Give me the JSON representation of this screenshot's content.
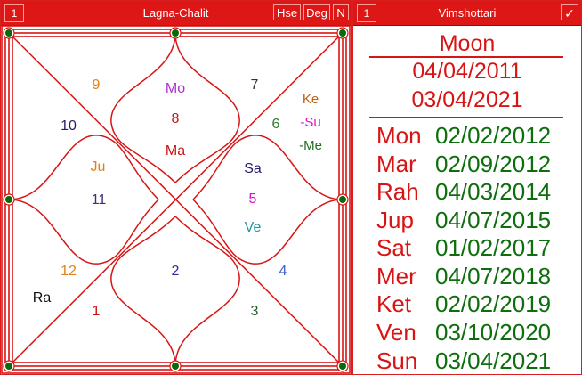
{
  "left_panel": {
    "number": "1",
    "title": "Lagna-Chalit",
    "buttons": {
      "hse": "Hse",
      "deg": "Deg",
      "n": "N"
    },
    "houses": [
      {
        "num": "1",
        "color": "#cc1111"
      },
      {
        "num": "2",
        "color": "#2c2c9a"
      },
      {
        "num": "3",
        "color": "#1e5c1e"
      },
      {
        "num": "4",
        "color": "#3c5ec8"
      },
      {
        "num": "5",
        "color": "#e010c8"
      },
      {
        "num": "6",
        "color": "#2e7d2e"
      },
      {
        "num": "7",
        "color": "#333333"
      },
      {
        "num": "8",
        "color": "#cc1111"
      },
      {
        "num": "9",
        "color": "#e08214"
      },
      {
        "num": "10",
        "color": "#2a1a6a"
      },
      {
        "num": "11",
        "color": "#4a2a7a"
      },
      {
        "num": "12",
        "color": "#e08214"
      }
    ],
    "planets": [
      {
        "label": "Mo",
        "color": "#b030d0"
      },
      {
        "label": "Ma",
        "color": "#cc1111"
      },
      {
        "label": "Ke",
        "color": "#c06010"
      },
      {
        "label": "-Su",
        "color": "#e010c8"
      },
      {
        "label": "-Me",
        "color": "#1e6e1e"
      },
      {
        "label": "Ju",
        "color": "#e08214"
      },
      {
        "label": "Sa",
        "color": "#2a1a6a"
      },
      {
        "label": "Ve",
        "color": "#1a9aa0"
      },
      {
        "label": "Ra",
        "color": "#111111"
      }
    ]
  },
  "right_panel": {
    "number": "1",
    "title": "Vimshottari",
    "check_glyph": "✓",
    "planet": "Moon",
    "start_date": "04/04/2011",
    "end_date": "03/04/2021",
    "periods": [
      {
        "planet": "Mon",
        "date": "02/02/2012"
      },
      {
        "planet": "Mar",
        "date": "02/09/2012"
      },
      {
        "planet": "Rah",
        "date": "04/03/2014"
      },
      {
        "planet": "Jup",
        "date": "04/07/2015"
      },
      {
        "planet": "Sat",
        "date": "01/02/2017"
      },
      {
        "planet": "Mer",
        "date": "04/07/2018"
      },
      {
        "planet": "Ket",
        "date": "02/02/2019"
      },
      {
        "planet": "Ven",
        "date": "03/10/2020"
      },
      {
        "planet": "Sun",
        "date": "03/04/2021"
      }
    ]
  }
}
